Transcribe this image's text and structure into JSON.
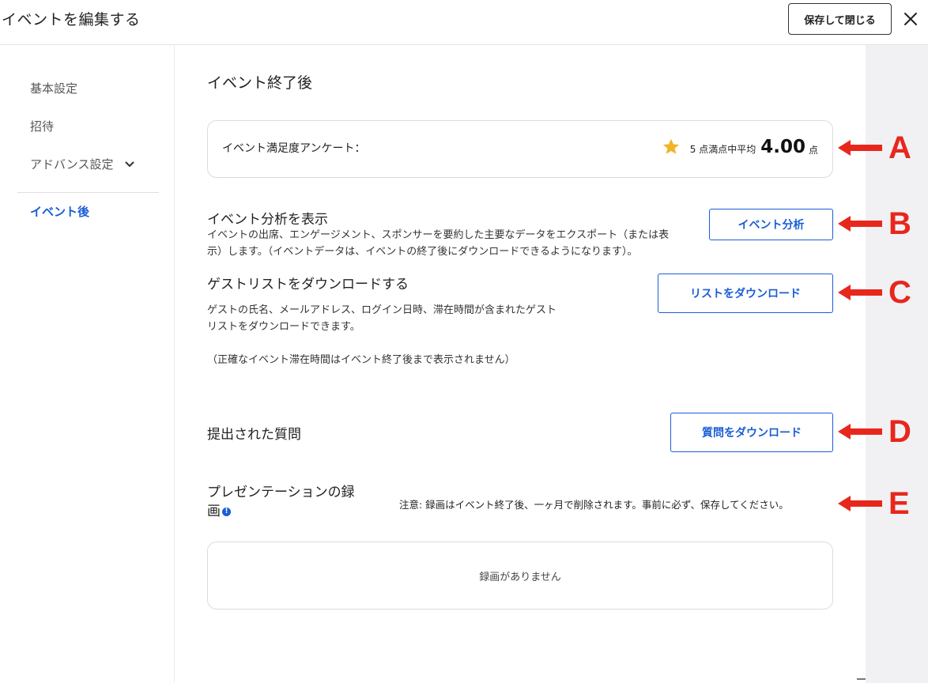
{
  "header": {
    "title": "イベントを編集する",
    "save_close_label": "保存して閉じる"
  },
  "sidebar": {
    "items": [
      {
        "label": "基本設定"
      },
      {
        "label": "招待"
      },
      {
        "label": "アドバンス設定"
      },
      {
        "label": "イベント後"
      }
    ]
  },
  "main": {
    "section_title": "イベント終了後",
    "survey": {
      "label": "イベント満足度アンケート：",
      "prefix": "5 点満点中平均",
      "value": "4.00",
      "unit": "点"
    },
    "analytics": {
      "title": "イベント分析を表示",
      "desc_line1": "イベントの出席、エンゲージメント、スポンサーを要約した主要なデータをエクスポート（または表",
      "desc_line2": "示）します。（イベントデータは、イベントの終了後にダウンロードできるようになります）。",
      "button_label": "イベント分析"
    },
    "guest_list": {
      "title": "ゲストリストをダウンロードする",
      "desc_line1": "ゲストの氏名、メールアドレス、ログイン日時、滞在時間が含まれたゲスト",
      "desc_line2": "リストをダウンロードできます。",
      "note": "（正確なイベント滞在時間はイベント終了後まで表示されません）",
      "button_label": "リストをダウンロード"
    },
    "questions": {
      "title": "提出された質問",
      "button_label": "質問をダウンロード"
    },
    "recordings": {
      "title_line1": "プレゼンテーションの録",
      "title_line2": "画",
      "info_glyph": "!",
      "note": "注意: 録画はイベント終了後、一ヶ月で削除されます。事前に必ず、保存してください。",
      "empty_text": "録画がありません"
    }
  },
  "annotations": [
    "A",
    "B",
    "C",
    "D",
    "E"
  ],
  "colors": {
    "accent": "#1a5dd6",
    "star": "#f0b429",
    "callout": "#e8271c"
  }
}
